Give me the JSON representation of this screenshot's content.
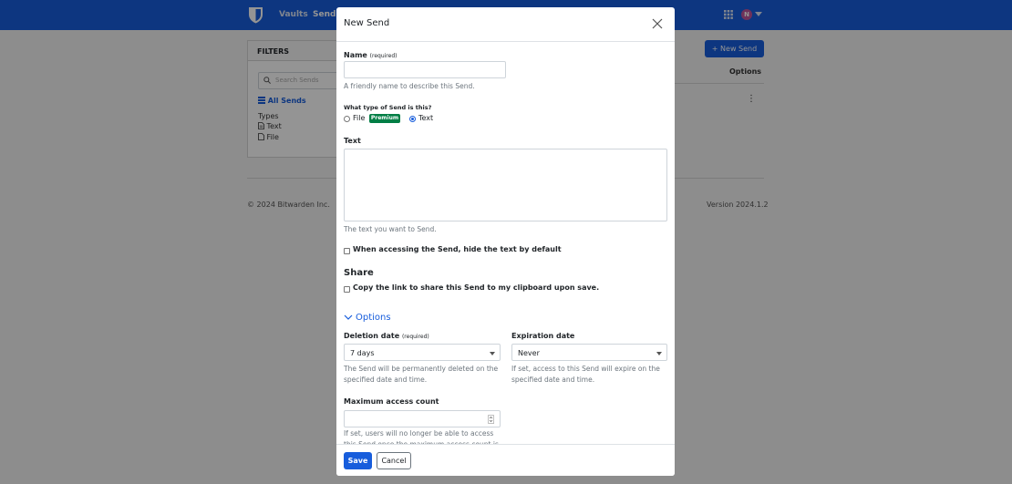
{
  "nav": {
    "vaults": "Vaults",
    "send": "Send",
    "avatar_initial": "N"
  },
  "filters": {
    "title": "FILTERS",
    "search_placeholder": "Search Sends",
    "all_sends": "All Sends",
    "types_label": "Types",
    "type_text": "Text",
    "type_file": "File"
  },
  "main": {
    "new_send": "New Send",
    "options_header": "Options",
    "kebab": "⋮"
  },
  "footer": {
    "copyright": "© 2024 Bitwarden Inc.",
    "version": "Version 2024.1.2"
  },
  "modal": {
    "title": "New Send",
    "name_label": "Name",
    "name_required": "(required)",
    "name_value": "",
    "name_help": "A friendly name to describe this Send.",
    "type_question": "What type of Send is this?",
    "type_file": "File",
    "premium_badge": "Premium",
    "type_text": "Text",
    "type_selected": "Text",
    "text_label": "Text",
    "text_value": "",
    "text_help": "The text you want to Send.",
    "hide_text_label": "When accessing the Send, hide the text by default",
    "share_heading": "Share",
    "copy_link_label": "Copy the link to share this Send to my clipboard upon save.",
    "options_toggle": "Options",
    "deletion_label": "Deletion date",
    "deletion_required": "(required)",
    "deletion_value": "7 days",
    "deletion_help": "The Send will be permanently deleted on the specified date and time.",
    "expiration_label": "Expiration date",
    "expiration_value": "Never",
    "expiration_help": "If set, access to this Send will expire on the specified date and time.",
    "max_access_label": "Maximum access count",
    "max_access_value": "",
    "max_access_help": "If set, users will no longer be able to access this Send once the maximum access count is",
    "save": "Save",
    "cancel": "Cancel"
  },
  "colors": {
    "brand": "#175ddc",
    "premium": "#017e45"
  }
}
